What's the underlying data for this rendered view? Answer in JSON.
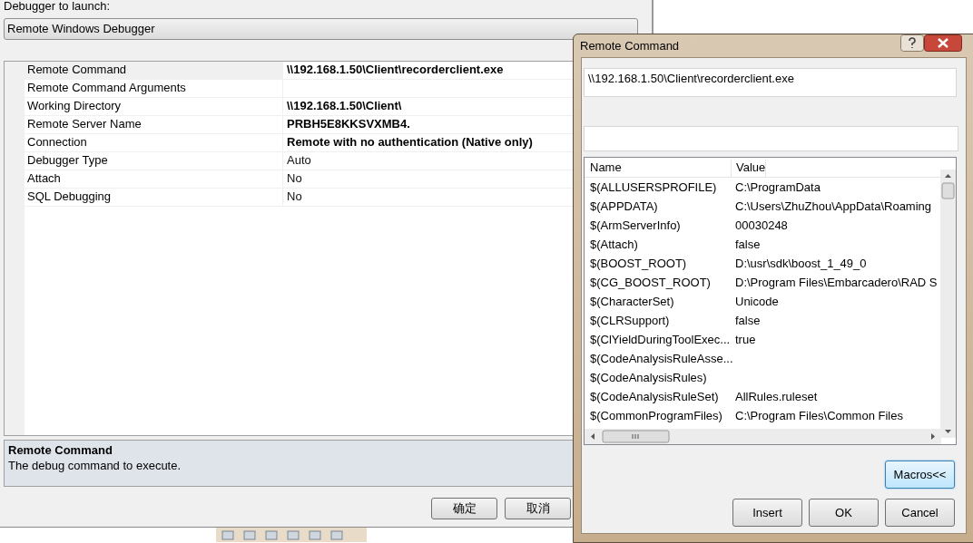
{
  "background_window": {
    "debugger_label": "Debugger to launch:",
    "debugger_dropdown": {
      "value": "Remote Windows Debugger"
    },
    "properties": [
      {
        "name": "Remote Command",
        "value": "\\\\192.168.1.50\\Client\\recorderclient.exe",
        "bold": true,
        "selected": true
      },
      {
        "name": "Remote Command Arguments",
        "selected": false
      },
      {
        "name": "Working Directory",
        "value": "\\\\192.168.1.50\\Client\\",
        "bold": true,
        "selected": false
      },
      {
        "name": "Remote Server Name",
        "value": "PRBH5E8KKSVXMB4.",
        "bold": true,
        "selected": false
      },
      {
        "name": "Connection",
        "value": "Remote with no authentication (Native only)",
        "bold": true,
        "selected": false
      },
      {
        "name": "Debugger Type",
        "value": "Auto",
        "bold": false,
        "selected": false
      },
      {
        "name": "Attach",
        "value": "No",
        "bold": false,
        "selected": false
      },
      {
        "name": "SQL Debugging",
        "value": "No",
        "bold": false,
        "selected": false
      }
    ],
    "description": {
      "title": "Remote Command",
      "text": "The debug command to execute."
    },
    "buttons": [
      "确定",
      "取消"
    ]
  },
  "dialog": {
    "title": "Remote Command",
    "command_value": "\\\\192.168.1.50\\Client\\recorderclient.exe",
    "macros": {
      "columns": [
        "Name",
        "Value"
      ],
      "rows": [
        {
          "name": "$(ALLUSERSPROFILE)",
          "value": "C:\\ProgramData"
        },
        {
          "name": "$(APPDATA)",
          "value": "C:\\Users\\ZhuZhou\\AppData\\Roaming"
        },
        {
          "name": "$(ArmServerInfo)",
          "value": "00030248"
        },
        {
          "name": "$(Attach)",
          "value": "false"
        },
        {
          "name": "$(BOOST_ROOT)",
          "value": "D:\\usr\\sdk\\boost_1_49_0"
        },
        {
          "name": "$(CG_BOOST_ROOT)",
          "value": "D:\\Program Files\\Embarcadero\\RAD S"
        },
        {
          "name": "$(CharacterSet)",
          "value": "Unicode"
        },
        {
          "name": "$(CLRSupport)",
          "value": "false"
        },
        {
          "name": "$(ClYieldDuringToolExec...",
          "value": "true"
        },
        {
          "name": "$(CodeAnalysisRuleAsse..."
        },
        {
          "name": "$(CodeAnalysisRules)"
        },
        {
          "name": "$(CodeAnalysisRuleSet)",
          "value": "AllRules.ruleset"
        },
        {
          "name": "$(CommonProgramFiles)",
          "value": "C:\\Program Files\\Common Files"
        }
      ]
    },
    "macros_button": {
      "label": "Macros<<",
      "focused": true
    },
    "buttons": [
      "Insert",
      "OK",
      "Cancel"
    ]
  }
}
